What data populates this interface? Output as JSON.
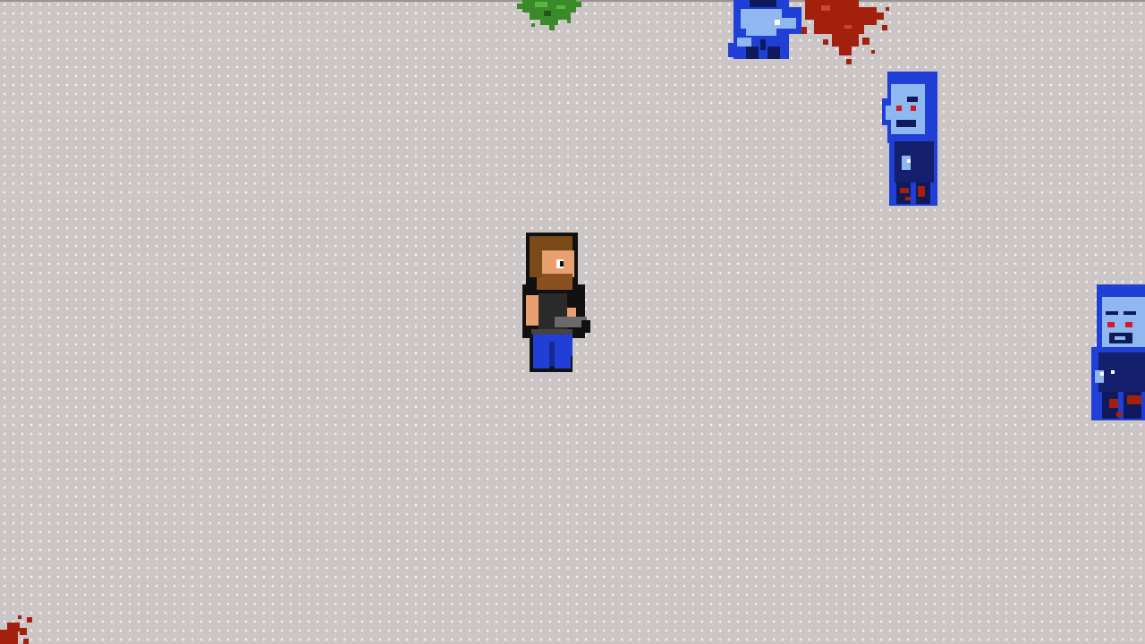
{
  "scene": {
    "type": "top-down survival shooter",
    "ground_color": "#cbc5c5",
    "ground_dot_color": "#f2eeee",
    "blood_color": "#a3200d",
    "slime_color": "#3a8a2a",
    "zombie_color": "#1f3fd6",
    "zombie_skin_color": "#8fb8f0"
  },
  "player": {
    "icon": "survivor-with-pistol",
    "facing": "right"
  },
  "enemies": [
    {
      "icon": "zombie-icon",
      "state": "partially-offscreen-top"
    },
    {
      "icon": "zombie-icon",
      "state": "walking"
    },
    {
      "icon": "zombie-icon",
      "state": "partially-offscreen-right"
    }
  ],
  "decals": [
    {
      "icon": "blood-splatter-icon"
    },
    {
      "icon": "green-slime-icon"
    },
    {
      "icon": "blood-splatter-icon"
    }
  ]
}
